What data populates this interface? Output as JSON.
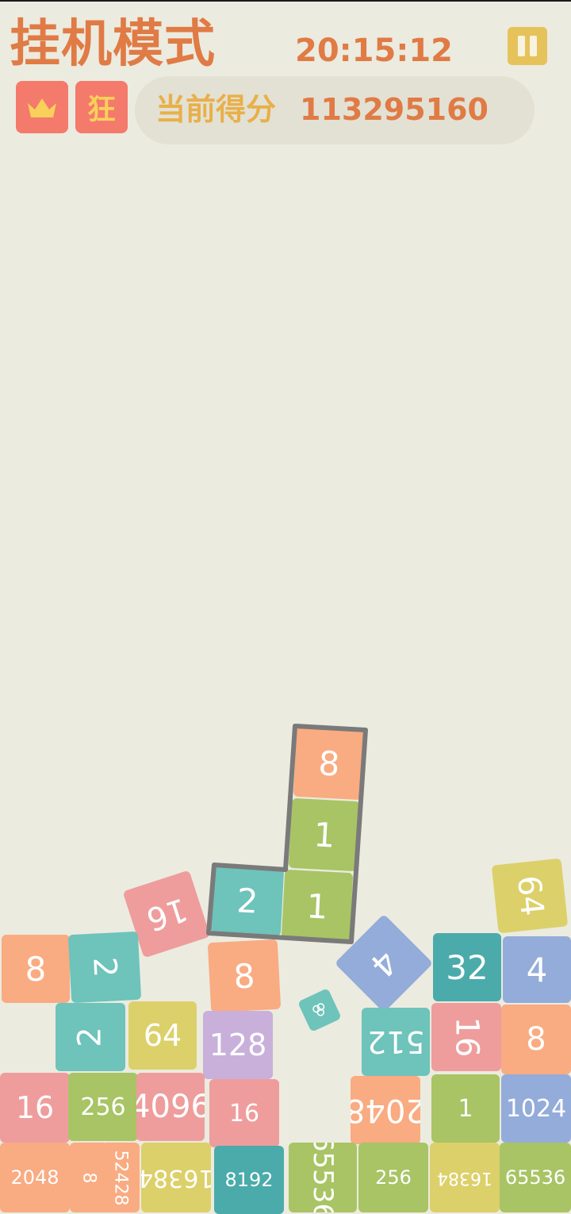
{
  "header": {
    "mode_title": "挂机模式",
    "clock": "20:15:12",
    "crazy_badge": "狂",
    "score_label": "当前得分",
    "score_value": "113295160"
  },
  "colors": {
    "background": "#ecebdf",
    "accent_orange": "#e07b45",
    "accent_gold": "#e8b04a",
    "badge_red": "#f47a6c",
    "pause_yellow": "#e6c25a"
  },
  "icons": {
    "crown": "crown-icon",
    "pause": "pause-icon"
  },
  "active_piece": [
    {
      "value": "8",
      "color": "#f9ab82"
    },
    {
      "value": "1",
      "color": "#a8c465"
    },
    {
      "value": "2",
      "color": "#6ec3bb"
    },
    {
      "value": "1",
      "color": "#a8c465"
    }
  ],
  "tiles": [
    {
      "value": "16",
      "color": "#ee9d9c"
    },
    {
      "value": "64",
      "color": "#dcd06a"
    },
    {
      "value": "8",
      "color": "#f9ab82"
    },
    {
      "value": "2",
      "color": "#6ec3bb"
    },
    {
      "value": "8",
      "color": "#f9ab82"
    },
    {
      "value": "4",
      "color": "#94acd9"
    },
    {
      "value": "32",
      "color": "#4aabaa"
    },
    {
      "value": "4",
      "color": "#94acd9"
    },
    {
      "value": "2",
      "color": "#6ec3bb"
    },
    {
      "value": "64",
      "color": "#dcd06a"
    },
    {
      "value": "128",
      "color": "#c8b0db"
    },
    {
      "value": "512",
      "color": "#6ec3bb"
    },
    {
      "value": "16",
      "color": "#ee9d9c"
    },
    {
      "value": "8",
      "color": "#f9ab82"
    },
    {
      "value": "16",
      "color": "#ee9d9c"
    },
    {
      "value": "256",
      "color": "#a8c465"
    },
    {
      "value": "4096",
      "color": "#ee9d9c"
    },
    {
      "value": "16",
      "color": "#ee9d9c"
    },
    {
      "value": "2048",
      "color": "#f9ab82"
    },
    {
      "value": "1",
      "color": "#a8c465"
    },
    {
      "value": "1024",
      "color": "#94acd9"
    },
    {
      "value": "2048",
      "color": "#f9ab82"
    },
    {
      "value": "16384",
      "color": "#dcd06a"
    },
    {
      "value": "8",
      "color": "#f9ab82"
    },
    {
      "value": "52428",
      "color": "#f9ab82"
    },
    {
      "value": "8192",
      "color": "#4aabaa"
    },
    {
      "value": "65536",
      "color": "#a8c465"
    },
    {
      "value": "256",
      "color": "#a8c465"
    },
    {
      "value": "16384",
      "color": "#dcd06a"
    },
    {
      "value": "65536",
      "color": "#a8c465"
    },
    {
      "value": "16384",
      "color": "#dcd06a"
    }
  ]
}
